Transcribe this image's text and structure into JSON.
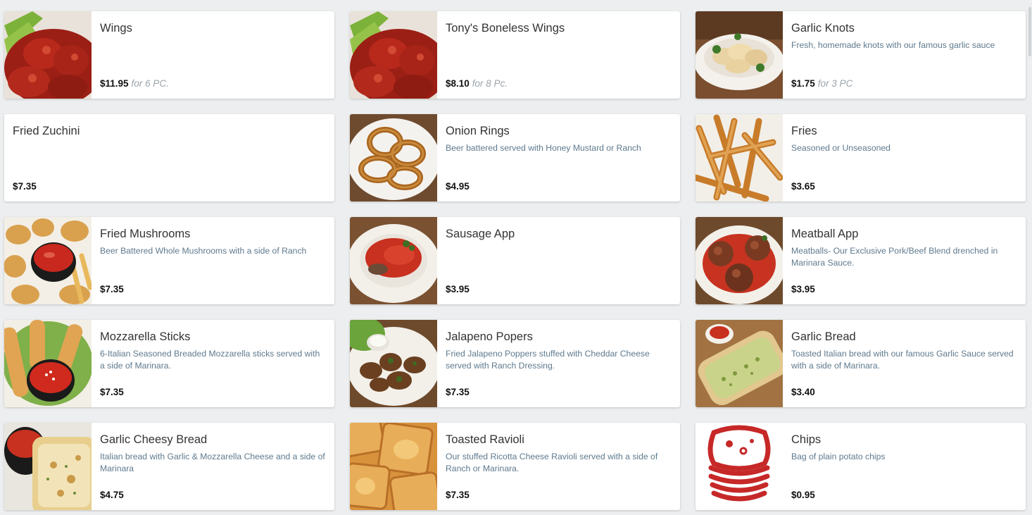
{
  "menu": {
    "items": [
      {
        "name": "Wings",
        "desc": "",
        "price": "$11.95",
        "qty": "for 6 PC.",
        "img": "wings-image"
      },
      {
        "name": "Tony's Boneless Wings",
        "desc": "",
        "price": "$8.10",
        "qty": "for 8 Pc.",
        "img": "wings-image"
      },
      {
        "name": "Garlic Knots",
        "desc": "Fresh, homemade knots with our famous garlic sauce",
        "price": "$1.75",
        "qty": "for 3 PC",
        "img": "garlic-knots-image"
      },
      {
        "name": "Fried Zuchini",
        "desc": "",
        "price": "$7.35",
        "qty": "",
        "img": ""
      },
      {
        "name": "Onion Rings",
        "desc": "Beer battered served with Honey Mustard or Ranch",
        "price": "$4.95",
        "qty": "",
        "img": "onion-rings-image"
      },
      {
        "name": "Fries",
        "desc": "Seasoned or Unseasoned",
        "price": "$3.65",
        "qty": "",
        "img": "fries-image"
      },
      {
        "name": "Fried Mushrooms",
        "desc": "Beer Battered Whole Mushrooms with a side of Ranch",
        "price": "$7.35",
        "qty": "",
        "img": "fried-mushrooms-image"
      },
      {
        "name": "Sausage App",
        "desc": "",
        "price": "$3.95",
        "qty": "",
        "img": "sausage-app-image"
      },
      {
        "name": "Meatball App",
        "desc": "Meatballs- Our Exclusive Pork/Beef Blend drenched in Marinara Sauce.",
        "price": "$3.95",
        "qty": "",
        "img": "meatball-app-image"
      },
      {
        "name": "Mozzarella Sticks",
        "desc": "6-Italian Seasoned Breaded Mozzarella sticks served with a side of Marinara.",
        "price": "$7.35",
        "qty": "",
        "img": "mozzarella-sticks-image"
      },
      {
        "name": "Jalapeno Popers",
        "desc": "Fried Jalapeno Poppers stuffed with Cheddar Cheese served with Ranch Dressing.",
        "price": "$7.35",
        "qty": "",
        "img": "jalapeno-poppers-image"
      },
      {
        "name": "Garlic Bread",
        "desc": "Toasted Italian bread with our famous Garlic Sauce served with a side of Marinara.",
        "price": "$3.40",
        "qty": "",
        "img": "garlic-bread-image"
      },
      {
        "name": "Garlic Cheesy Bread",
        "desc": "Italian bread with Garlic & Mozzarella Cheese and a side of Marinara",
        "price": "$4.75",
        "qty": "",
        "img": "garlic-cheesy-bread-image"
      },
      {
        "name": "Toasted Ravioli",
        "desc": "Our stuffed Ricotta Cheese Ravioli served with a side of Ranch or Marinara.",
        "price": "$7.35",
        "qty": "",
        "img": "toasted-ravioli-image"
      },
      {
        "name": "Chips",
        "desc": "Bag of plain potato chips",
        "price": "$0.95",
        "qty": "",
        "img": "chips-icon"
      }
    ]
  },
  "colors": {
    "accent": "#d32f2f",
    "desc": "#5f7a8e"
  }
}
